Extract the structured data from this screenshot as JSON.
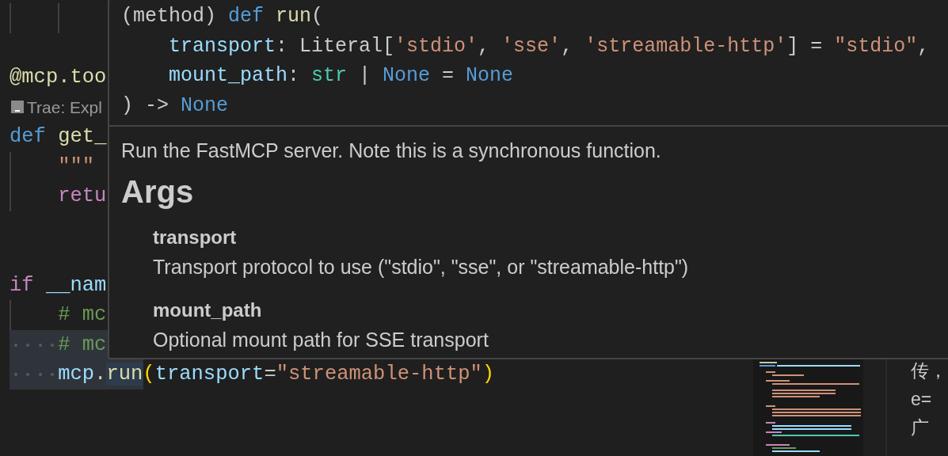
{
  "editor": {
    "lines": [
      {
        "kind": "offscreen",
        "children": [
          {
            "kind": "offscreen",
            "children": [
              {
                "kind": "blank"
              }
            ]
          }
        ]
      },
      {
        "kind": "blank"
      },
      {
        "kind": "code",
        "selected": false,
        "tokens": [
          {
            "text": "@mcp.too",
            "kind": "function"
          }
        ]
      },
      {
        "kind": "codelens",
        "text": "Trae: Expl"
      },
      {
        "kind": "code",
        "selected": false,
        "tokens": [
          {
            "text": "def",
            "kind": "keyword"
          },
          {
            "text": "get_",
            "kind": "function",
            "space_before": true
          }
        ],
        "children": [
          {
            "kind": "code",
            "selected": false,
            "tokens": [
              {
                "text": "\"\"\"",
                "kind": "string"
              }
            ]
          },
          {
            "kind": "code",
            "selected": false,
            "tokens": [
              {
                "text": "retu",
                "kind": "control"
              }
            ]
          }
        ]
      },
      {
        "kind": "blank"
      },
      {
        "kind": "blank"
      },
      {
        "kind": "code",
        "selected": false,
        "tokens": [
          {
            "text": "if",
            "kind": "control"
          },
          {
            "text": "__nam",
            "kind": "variable",
            "space_before": true
          }
        ],
        "children": [
          {
            "kind": "code",
            "selected": false,
            "tokens": [
              {
                "text": "# mc",
                "kind": "comment"
              }
            ]
          },
          {
            "kind": "code",
            "selected": true,
            "tokens": [
              {
                "text": "# mc",
                "kind": "comment"
              }
            ]
          },
          {
            "kind": "code",
            "selected": true,
            "tokens": [
              {
                "text": "mcp",
                "kind": "variable"
              },
              {
                "text": ".",
                "kind": "plain"
              },
              {
                "text": "run",
                "kind": "function",
                "highlighted": true
              },
              {
                "text": "(",
                "kind": "bracket"
              },
              {
                "text": "transport",
                "kind": "variable"
              },
              {
                "text": "=",
                "kind": "plain"
              },
              {
                "text": "\"streamable-http\"",
                "kind": "string"
              },
              {
                "text": ")",
                "kind": "bracket"
              }
            ]
          }
        ]
      }
    ]
  },
  "hover": {
    "signature": [
      {
        "indented": false,
        "tokens": [
          {
            "text": "(method)",
            "kind": "plain"
          },
          {
            "text": "def",
            "kind": "keyword",
            "space_before": true
          },
          {
            "text": "run",
            "kind": "function",
            "space_before": true
          },
          {
            "text": "(",
            "kind": "plain"
          }
        ]
      },
      {
        "indented": true,
        "tokens": [
          {
            "text": "transport",
            "kind": "variable"
          },
          {
            "text": ": Literal[",
            "kind": "plain"
          },
          {
            "text": "'stdio'",
            "kind": "string"
          },
          {
            "text": ", ",
            "kind": "plain"
          },
          {
            "text": "'sse'",
            "kind": "string"
          },
          {
            "text": ", ",
            "kind": "plain"
          },
          {
            "text": "'streamable-http'",
            "kind": "string"
          },
          {
            "text": "] = ",
            "kind": "plain"
          },
          {
            "text": "\"stdio\"",
            "kind": "string"
          },
          {
            "text": ",",
            "kind": "plain"
          }
        ]
      },
      {
        "indented": true,
        "tokens": [
          {
            "text": "mount_path",
            "kind": "variable"
          },
          {
            "text": ": ",
            "kind": "plain"
          },
          {
            "text": "str",
            "kind": "type"
          },
          {
            "text": " | ",
            "kind": "plain"
          },
          {
            "text": "None",
            "kind": "keyword"
          },
          {
            "text": " = ",
            "kind": "plain"
          },
          {
            "text": "None",
            "kind": "keyword"
          }
        ]
      },
      {
        "indented": false,
        "tokens": [
          {
            "text": ") -> ",
            "kind": "plain"
          },
          {
            "text": "None",
            "kind": "keyword"
          }
        ]
      }
    ],
    "summary": "Run the FastMCP server. Note this is a synchronous function.",
    "heading": "Args",
    "args": [
      {
        "name": "transport",
        "description": "Transport protocol to use (\"stdio\", \"sse\", or \"streamable-http\")"
      },
      {
        "name": "mount_path",
        "description": "Optional mount path for SSE transport"
      }
    ]
  },
  "side_panel": {
    "lines": [
      "传，",
      "e=",
      "广"
    ]
  }
}
